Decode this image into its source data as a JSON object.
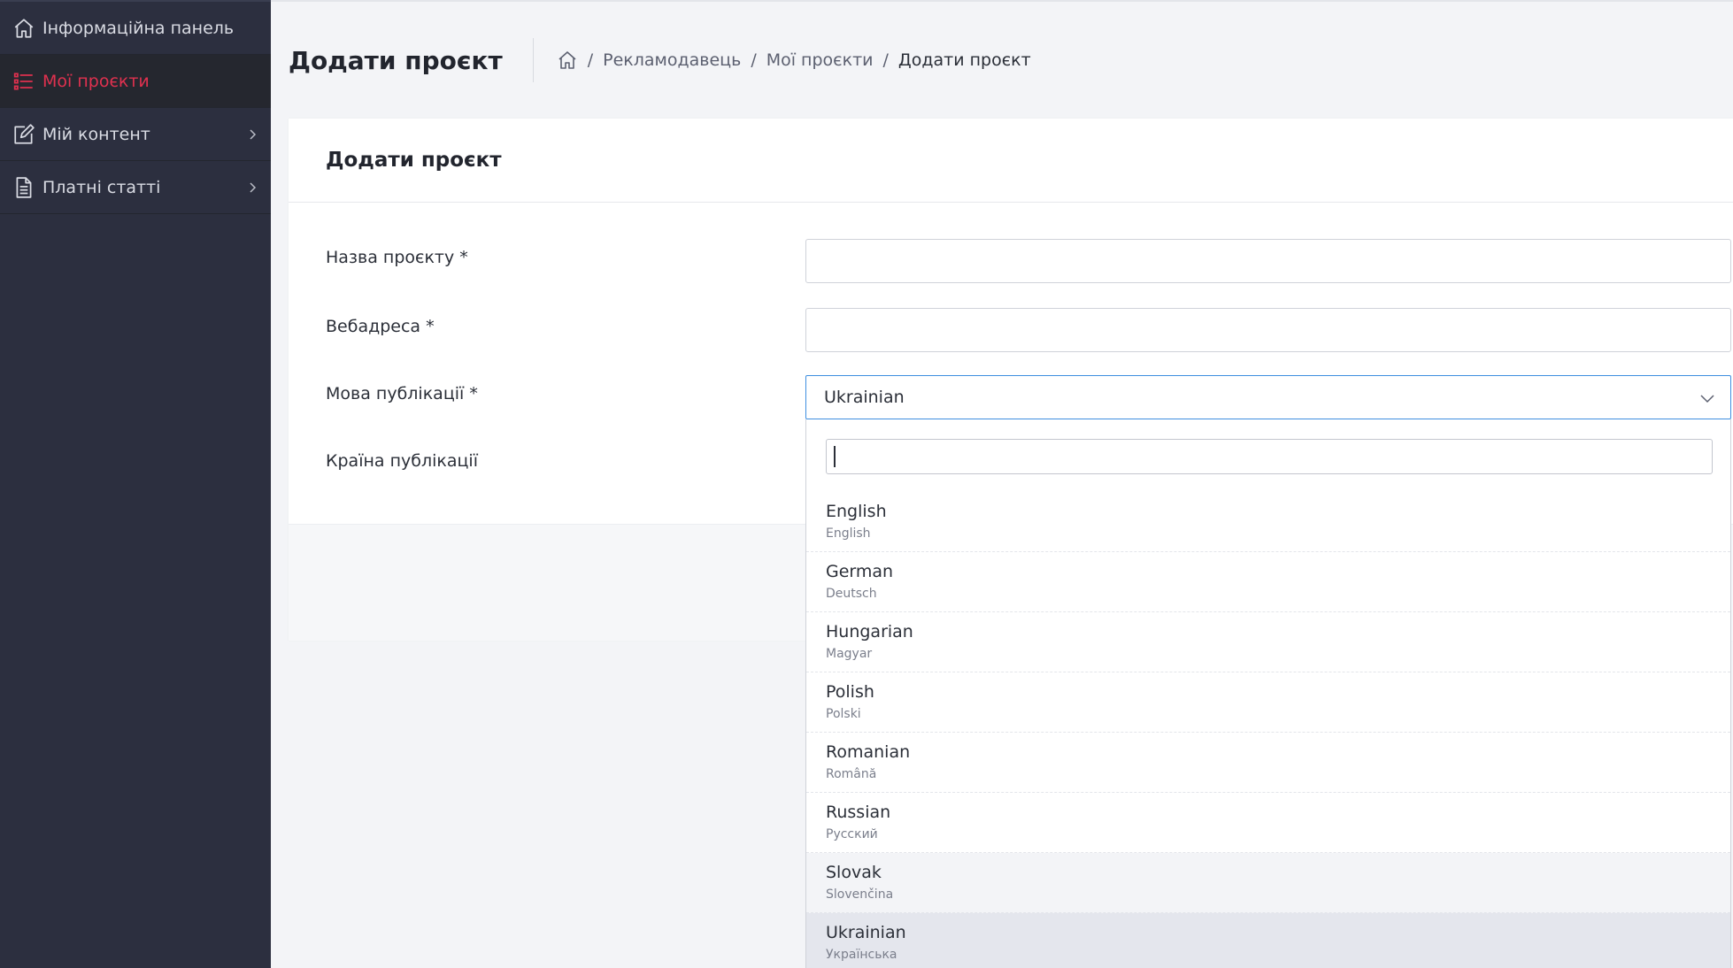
{
  "sidebar": {
    "items": [
      {
        "label": "Інформаційна панель",
        "icon": "home-icon",
        "active": false,
        "has_children": false
      },
      {
        "label": "Мої проєкти",
        "icon": "list-icon",
        "active": true,
        "has_children": false
      },
      {
        "label": "Мій контент",
        "icon": "edit-icon",
        "active": false,
        "has_children": true
      },
      {
        "label": "Платні статті",
        "icon": "document-icon",
        "active": false,
        "has_children": true
      }
    ]
  },
  "header": {
    "title": "Додати проєкт",
    "breadcrumb": {
      "home_icon": "home-icon",
      "items": [
        "Рекламодавець",
        "Мої проєкти",
        "Додати проєкт"
      ],
      "separator": "/"
    }
  },
  "card": {
    "title": "Додати проєкт",
    "fields": {
      "project_name": {
        "label": "Назва проєкту *",
        "value": ""
      },
      "web_address": {
        "label": "Вебадреса *",
        "value": ""
      },
      "language": {
        "label": "Мова публікації *",
        "value": "Ukrainian"
      },
      "country": {
        "label": "Країна публікації"
      }
    }
  },
  "dropdown": {
    "search_value": "",
    "options": [
      {
        "name": "English",
        "native": "English"
      },
      {
        "name": "German",
        "native": "Deutsch"
      },
      {
        "name": "Hungarian",
        "native": "Magyar"
      },
      {
        "name": "Polish",
        "native": "Polski"
      },
      {
        "name": "Romanian",
        "native": "Română"
      },
      {
        "name": "Russian",
        "native": "Русский"
      },
      {
        "name": "Slovak",
        "native": "Slovenčina"
      },
      {
        "name": "Ukrainian",
        "native": "Українська"
      }
    ],
    "hovered": "Slovak",
    "selected": "Ukrainian"
  },
  "colors": {
    "sidebar_bg": "#2c2f3f",
    "active_accent": "#e0314f",
    "focus_border": "#3f8fe0"
  }
}
